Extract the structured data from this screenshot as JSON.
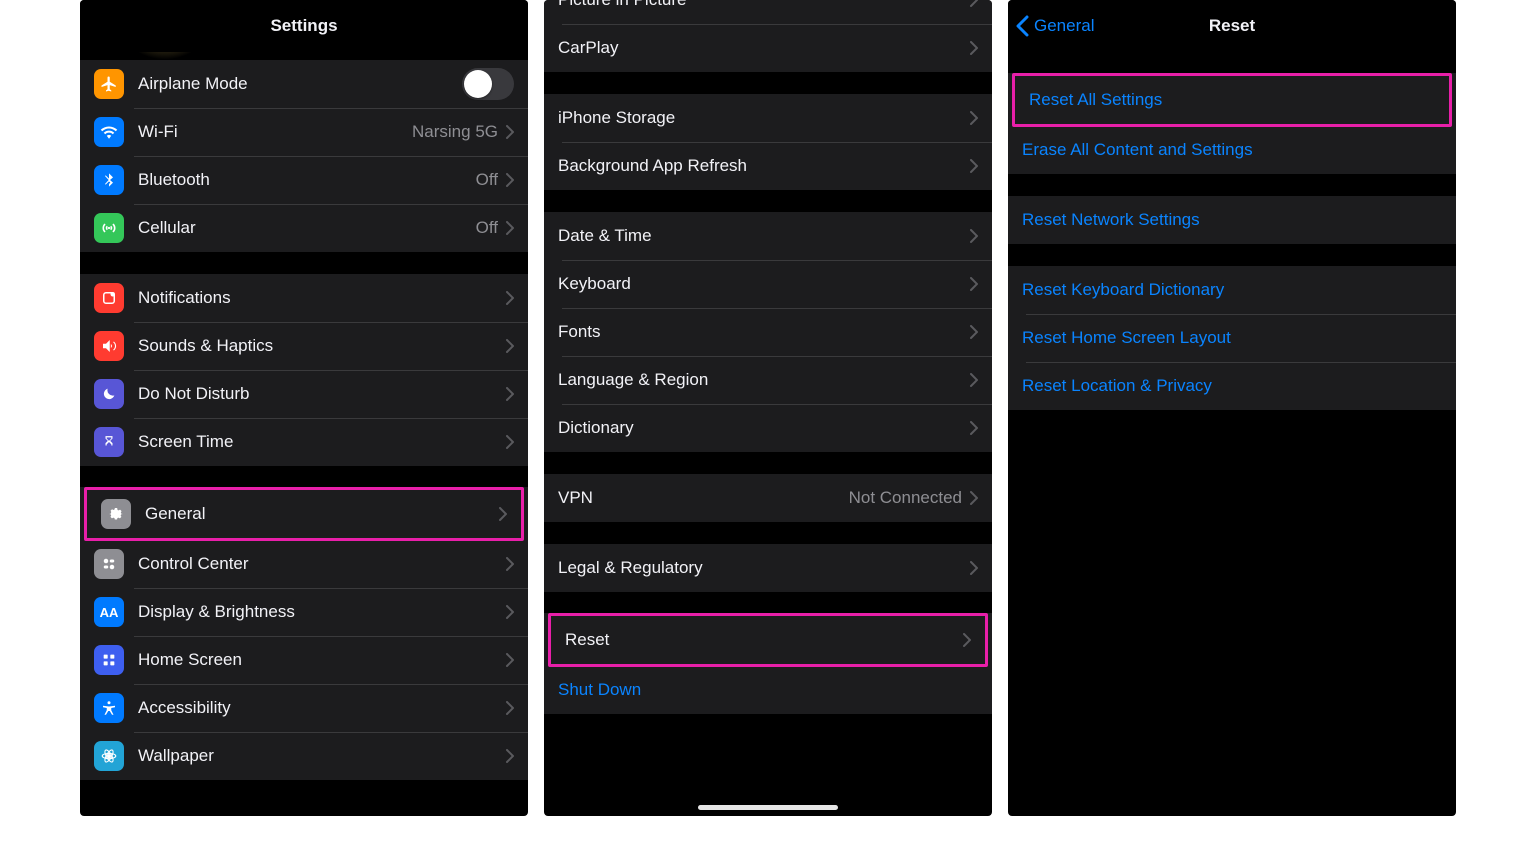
{
  "panel1": {
    "title": "Settings",
    "group1": [
      {
        "key": "airplane",
        "label": "Airplane Mode",
        "toggle": false
      },
      {
        "key": "wifi",
        "label": "Wi-Fi",
        "value": "Narsing 5G"
      },
      {
        "key": "bluetooth",
        "label": "Bluetooth",
        "value": "Off"
      },
      {
        "key": "cellular",
        "label": "Cellular",
        "value": "Off"
      }
    ],
    "group2": [
      {
        "key": "notifications",
        "label": "Notifications"
      },
      {
        "key": "sounds",
        "label": "Sounds & Haptics"
      },
      {
        "key": "dnd",
        "label": "Do Not Disturb"
      },
      {
        "key": "screentime",
        "label": "Screen Time"
      }
    ],
    "group3": [
      {
        "key": "general",
        "label": "General",
        "highlight": true
      },
      {
        "key": "control_center",
        "label": "Control Center"
      },
      {
        "key": "display",
        "label": "Display & Brightness"
      },
      {
        "key": "home_screen",
        "label": "Home Screen"
      },
      {
        "key": "accessibility",
        "label": "Accessibility"
      },
      {
        "key": "wallpaper",
        "label": "Wallpaper"
      }
    ]
  },
  "panel2": {
    "group1": [
      {
        "key": "pip",
        "label": "Picture in Picture"
      },
      {
        "key": "carplay",
        "label": "CarPlay"
      }
    ],
    "group2": [
      {
        "key": "storage",
        "label": "iPhone Storage"
      },
      {
        "key": "bg_refresh",
        "label": "Background App Refresh"
      }
    ],
    "group3": [
      {
        "key": "date_time",
        "label": "Date & Time"
      },
      {
        "key": "keyboard",
        "label": "Keyboard"
      },
      {
        "key": "fonts",
        "label": "Fonts"
      },
      {
        "key": "lang_region",
        "label": "Language & Region"
      },
      {
        "key": "dictionary",
        "label": "Dictionary"
      }
    ],
    "group4": [
      {
        "key": "vpn",
        "label": "VPN",
        "value": "Not Connected"
      }
    ],
    "group5": [
      {
        "key": "legal",
        "label": "Legal & Regulatory"
      }
    ],
    "group6": [
      {
        "key": "reset",
        "label": "Reset",
        "highlight": true
      },
      {
        "key": "shutdown",
        "label": "Shut Down",
        "link": true
      }
    ]
  },
  "panel3": {
    "back_label": "General",
    "title": "Reset",
    "group1": [
      {
        "key": "reset_all",
        "label": "Reset All Settings",
        "highlight": true
      },
      {
        "key": "erase_all",
        "label": "Erase All Content and Settings"
      }
    ],
    "group2": [
      {
        "key": "reset_network",
        "label": "Reset Network Settings"
      }
    ],
    "group3": [
      {
        "key": "reset_keyboard",
        "label": "Reset Keyboard Dictionary"
      },
      {
        "key": "reset_home",
        "label": "Reset Home Screen Layout"
      },
      {
        "key": "reset_location",
        "label": "Reset Location & Privacy"
      }
    ]
  },
  "colors": {
    "highlight": "#e81fa9",
    "link": "#0a84ff"
  }
}
